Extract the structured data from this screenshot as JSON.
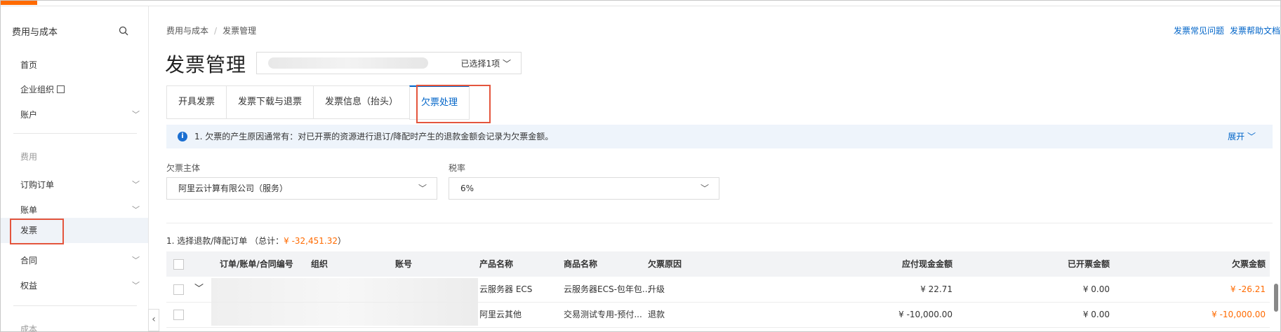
{
  "sidebar": {
    "title": "费用与成本",
    "items": [
      {
        "label": "首页"
      },
      {
        "label": "企业组织"
      },
      {
        "label": "账户"
      },
      {
        "label": "订购订单"
      },
      {
        "label": "账单"
      },
      {
        "label": "发票"
      },
      {
        "label": "合同"
      },
      {
        "label": "权益"
      }
    ],
    "groups": [
      {
        "label": "费用"
      },
      {
        "label": "成本"
      }
    ]
  },
  "breadcrumb": {
    "root": "费用与成本",
    "current": "发票管理"
  },
  "toplinks": {
    "faq": "发票常见问题",
    "help": "发票帮助文档"
  },
  "page": {
    "title": "发票管理",
    "account_selected": "已选择1项"
  },
  "tabs": [
    {
      "label": "开具发票"
    },
    {
      "label": "发票下载与退票"
    },
    {
      "label": "发票信息（抬头）"
    },
    {
      "label": "欠票处理"
    }
  ],
  "notice": {
    "text": "1. 欠票的产生原因通常有：对已开票的资源进行退订/降配时产生的退款金额会记录为欠票金额。",
    "expand": "展开"
  },
  "filters": {
    "entity_label": "欠票主体",
    "entity_value": "阿里云计算有限公司（服务）",
    "tax_label": "税率",
    "tax_value": "6%"
  },
  "section": {
    "title": "1. 选择退款/降配订单 （总计：",
    "total": "¥ -32,451.32",
    "close": "）"
  },
  "table": {
    "columns": [
      "订单/账单/合同编号",
      "组织",
      "账号",
      "产品名称",
      "商品名称",
      "欠票原因",
      "应付现金金额",
      "已开票金额",
      "欠票金额"
    ],
    "rows": [
      {
        "product": "云服务器 ECS",
        "goods": "云服务器ECS-包年包...",
        "reason": "升级",
        "payable": "¥ 22.71",
        "invoiced": "¥ 0.00",
        "owed": "¥ -26.21"
      },
      {
        "product": "阿里云其他",
        "goods": "交易测试专用-预付...",
        "reason": "退款",
        "payable": "¥ -10,000.00",
        "invoiced": "¥ 0.00",
        "owed": "¥ -10,000.00"
      }
    ]
  },
  "colors": {
    "accent": "#0064c8",
    "brand": "#ff6a00",
    "highlight": "#e4553d"
  }
}
